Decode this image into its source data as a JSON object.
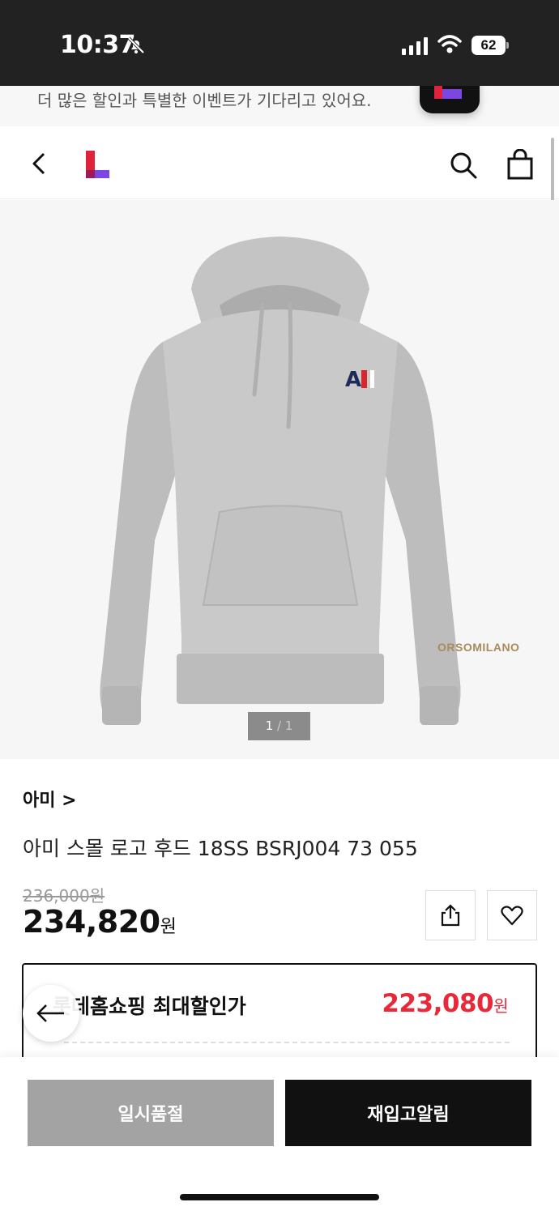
{
  "status_bar": {
    "time": "10:37",
    "battery": "62",
    "icons": [
      "bell-off-icon",
      "cellular-signal-icon",
      "wifi-icon",
      "battery-icon"
    ]
  },
  "promo": {
    "text": "더 많은 할인과 특별한 이벤트가 기다리고 있어요."
  },
  "header": {
    "icons": [
      "back-icon",
      "lotte-on-logo",
      "search-icon",
      "shopping-bag-icon"
    ]
  },
  "gallery": {
    "current": "1",
    "separator": "/",
    "total": "1",
    "watermark": "ORSOMILANO"
  },
  "product": {
    "brand": "아미 >",
    "name": "아미 스몰 로고 후드 18SS BSRJ004 73 055",
    "original_price": "236,000원",
    "sale_price": "234,820",
    "sale_unit": "원"
  },
  "discount": {
    "label": "롯데홈쇼핑 최대할인가",
    "price": "223,080",
    "unit": "원"
  },
  "actions": {
    "soldout_label": "일시품절",
    "restock_label": "재입고알림"
  },
  "colors": {
    "brand_red": "#e0223b",
    "brand_purple": "#7b47e0",
    "discount_red": "#e62a3a",
    "soldout_gray": "#a3a3a3"
  }
}
